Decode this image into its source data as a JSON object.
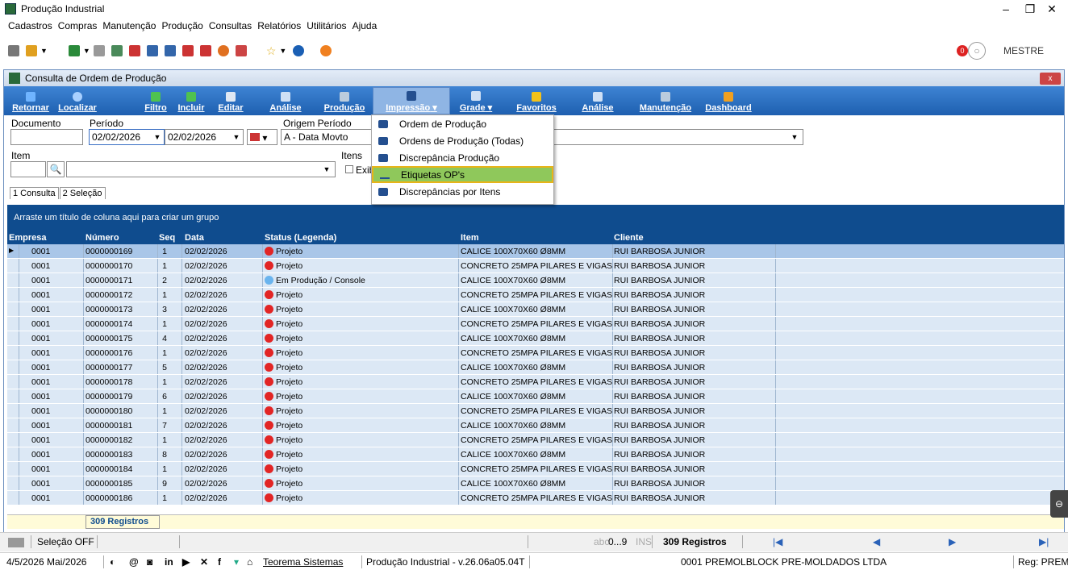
{
  "window": {
    "title": "Produção Industrial"
  },
  "menu": [
    "Cadastros",
    "Compras",
    "Manutenção",
    "Produção",
    "Consultas",
    "Relatórios",
    "Utilitários",
    "Ajuda"
  ],
  "user": {
    "name": "MESTRE",
    "notifications": "0"
  },
  "inner": {
    "title": "Consulta de Ordem de Produção",
    "close": "x"
  },
  "ribbon": [
    "Retornar",
    "Localizar",
    "Filtro",
    "Incluir",
    "Editar",
    "Análise",
    "Produção",
    "Impressão",
    "Grade",
    "Favoritos",
    "Análise",
    "Manutenção",
    "Dashboard"
  ],
  "filters": {
    "documento_label": "Documento",
    "periodo_label": "Período",
    "periodo_de": "02/02/2026",
    "periodo_ate": "02/02/2026",
    "origem_label": "Origem Período",
    "origem_value": "A - Data Movto",
    "item_label": "Item",
    "itens_label": "Itens",
    "exib_label": "Exib"
  },
  "tabs": [
    "1 Consulta",
    "2 Seleção"
  ],
  "group_hint": "Arraste um título de coluna aqui para criar um grupo",
  "columns": [
    "Empresa",
    "Número",
    "Seq",
    "Data",
    "Status (Legenda)",
    "Item",
    "Cliente"
  ],
  "rows": [
    [
      "0001",
      "0000000169",
      "1",
      "02/02/2026",
      "Projeto",
      "CALICE 100X70X60 Ø8MM",
      "RUI BARBOSA JUNIOR"
    ],
    [
      "0001",
      "0000000170",
      "1",
      "02/02/2026",
      "Projeto",
      "CONCRETO 25MPA PILARES E VIGAS",
      "RUI BARBOSA JUNIOR"
    ],
    [
      "0001",
      "0000000171",
      "2",
      "02/02/2026",
      "Em Produção / Console",
      "CALICE 100X70X60 Ø8MM",
      "RUI BARBOSA JUNIOR"
    ],
    [
      "0001",
      "0000000172",
      "1",
      "02/02/2026",
      "Projeto",
      "CONCRETO 25MPA PILARES E VIGAS",
      "RUI BARBOSA JUNIOR"
    ],
    [
      "0001",
      "0000000173",
      "3",
      "02/02/2026",
      "Projeto",
      "CALICE 100X70X60 Ø8MM",
      "RUI BARBOSA JUNIOR"
    ],
    [
      "0001",
      "0000000174",
      "1",
      "02/02/2026",
      "Projeto",
      "CONCRETO 25MPA PILARES E VIGAS",
      "RUI BARBOSA JUNIOR"
    ],
    [
      "0001",
      "0000000175",
      "4",
      "02/02/2026",
      "Projeto",
      "CALICE 100X70X60 Ø8MM",
      "RUI BARBOSA JUNIOR"
    ],
    [
      "0001",
      "0000000176",
      "1",
      "02/02/2026",
      "Projeto",
      "CONCRETO 25MPA PILARES E VIGAS",
      "RUI BARBOSA JUNIOR"
    ],
    [
      "0001",
      "0000000177",
      "5",
      "02/02/2026",
      "Projeto",
      "CALICE 100X70X60 Ø8MM",
      "RUI BARBOSA JUNIOR"
    ],
    [
      "0001",
      "0000000178",
      "1",
      "02/02/2026",
      "Projeto",
      "CONCRETO 25MPA PILARES E VIGAS",
      "RUI BARBOSA JUNIOR"
    ],
    [
      "0001",
      "0000000179",
      "6",
      "02/02/2026",
      "Projeto",
      "CALICE 100X70X60 Ø8MM",
      "RUI BARBOSA JUNIOR"
    ],
    [
      "0001",
      "0000000180",
      "1",
      "02/02/2026",
      "Projeto",
      "CONCRETO 25MPA PILARES E VIGAS",
      "RUI BARBOSA JUNIOR"
    ],
    [
      "0001",
      "0000000181",
      "7",
      "02/02/2026",
      "Projeto",
      "CALICE 100X70X60 Ø8MM",
      "RUI BARBOSA JUNIOR"
    ],
    [
      "0001",
      "0000000182",
      "1",
      "02/02/2026",
      "Projeto",
      "CONCRETO 25MPA PILARES E VIGAS",
      "RUI BARBOSA JUNIOR"
    ],
    [
      "0001",
      "0000000183",
      "8",
      "02/02/2026",
      "Projeto",
      "CALICE 100X70X60 Ø8MM",
      "RUI BARBOSA JUNIOR"
    ],
    [
      "0001",
      "0000000184",
      "1",
      "02/02/2026",
      "Projeto",
      "CONCRETO 25MPA PILARES E VIGAS",
      "RUI BARBOSA JUNIOR"
    ],
    [
      "0001",
      "0000000185",
      "9",
      "02/02/2026",
      "Projeto",
      "CALICE 100X70X60 Ø8MM",
      "RUI BARBOSA JUNIOR"
    ],
    [
      "0001",
      "0000000186",
      "1",
      "02/02/2026",
      "Projeto",
      "CONCRETO 25MPA PILARES E VIGAS",
      "RUI BARBOSA JUNIOR"
    ]
  ],
  "status_colors": {
    "Projeto": "#e22525",
    "Em Produção / Console": "#6ab4ee"
  },
  "record_count": "309 Registros",
  "dropdown": [
    "Ordem de Produção",
    "Ordens de Produção (Todas)",
    "Discrepância Produção",
    "Etiquetas OP's",
    "Discrepâncias por Itens"
  ],
  "statusbar": {
    "selection": "Seleção OFF",
    "abc": "abc",
    "digits": "0...9",
    "ins": "INS",
    "count": "309 Registros"
  },
  "bottombar": {
    "date": "4/5/2026 Mai/2026",
    "link": "Teorema Sistemas",
    "version": "Produção Industrial - v.26.06a05.04T",
    "company": "0001 PREMOLBLOCK PRE-MOLDADOS LTDA",
    "reg": "Reg: PREMO"
  }
}
